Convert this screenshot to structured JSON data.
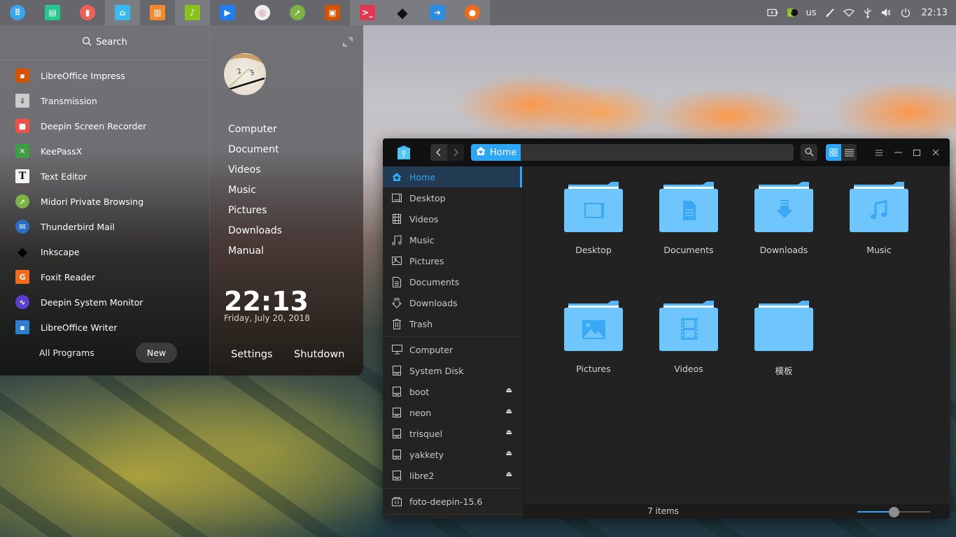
{
  "dock": {
    "apps": [
      {
        "name": "launcher",
        "icon": "launcher-icon",
        "color": "#3aa6f0",
        "active": false
      },
      {
        "name": "deepin-terminal-green",
        "icon": "window-manager-icon",
        "color": "#22c98a",
        "active": false
      },
      {
        "name": "screen-recorder",
        "icon": "screen-recorder-icon",
        "color": "#f06055",
        "active": false
      },
      {
        "name": "file-manager",
        "icon": "file-manager-icon",
        "color": "#3ab8f0",
        "active": true
      },
      {
        "name": "app-store",
        "icon": "app-store-icon",
        "color": "#f28a2b",
        "active": false
      },
      {
        "name": "music",
        "icon": "music-icon",
        "color": "#8ac21b",
        "active": true
      },
      {
        "name": "video-player",
        "icon": "video-player-icon",
        "color": "#1f7ff0",
        "active": false
      },
      {
        "name": "settings",
        "icon": "settings-icon",
        "color": "#ef6b7a",
        "active": false
      },
      {
        "name": "midori",
        "icon": "browser-icon",
        "color": "#7cb342",
        "active": false
      },
      {
        "name": "libreoffice-impress",
        "icon": "impress-icon",
        "color": "#d35400",
        "active": false
      },
      {
        "name": "terminal",
        "icon": "terminal-icon",
        "color": "#e0384e",
        "active": true
      },
      {
        "name": "inkscape",
        "icon": "inkscape-icon",
        "color": "#111111",
        "active": true
      },
      {
        "name": "remote-assist",
        "icon": "remote-icon",
        "color": "#2a8de0",
        "active": true
      },
      {
        "name": "firefox",
        "icon": "firefox-icon",
        "color": "#f26b1d",
        "active": true
      }
    ]
  },
  "tray": {
    "battery_icon": "battery-charging-icon",
    "music_icon": "music-tray-icon",
    "keyboard_layout": "us",
    "pen_icon": "pen-icon",
    "wifi_icon": "wifi-icon",
    "usb_icon": "usb-icon",
    "volume_icon": "volume-icon",
    "power_icon": "power-icon",
    "clock": "22:13"
  },
  "launcher": {
    "search_placeholder": "Search",
    "apps": [
      {
        "label": "LibreOffice Impress",
        "icon": "impress-icon",
        "color": "#d35400"
      },
      {
        "label": "Transmission",
        "icon": "transmission-icon",
        "color": "#cccccc"
      },
      {
        "label": "Deepin Screen Recorder",
        "icon": "screen-recorder-icon",
        "color": "#f0504a"
      },
      {
        "label": "KeePassX",
        "icon": "keepassx-icon",
        "color": "#3aa043"
      },
      {
        "label": "Text Editor",
        "icon": "text-editor-icon",
        "color": "#f4f4f4"
      },
      {
        "label": "Midori Private Browsing",
        "icon": "midori-icon",
        "color": "#7cb342"
      },
      {
        "label": "Thunderbird Mail",
        "icon": "thunderbird-icon",
        "color": "#2b6fc4"
      },
      {
        "label": "Inkscape",
        "icon": "inkscape-icon",
        "color": "#111111"
      },
      {
        "label": "Foxit Reader",
        "icon": "foxit-icon",
        "color": "#f26b1d"
      },
      {
        "label": "Deepin System Monitor",
        "icon": "system-monitor-icon",
        "color": "#5b3fd0"
      },
      {
        "label": "LibreOffice Writer",
        "icon": "writer-icon",
        "color": "#2a7fcf"
      }
    ],
    "all_programs_label": "All Programs",
    "new_label": "New",
    "places": [
      "Computer",
      "Document",
      "Videos",
      "Music",
      "Pictures",
      "Downloads",
      "Manual"
    ],
    "time": "22:13",
    "date": "Friday, July 20, 2018",
    "settings_label": "Settings",
    "shutdown_label": "Shutdown"
  },
  "file_manager": {
    "breadcrumb": "Home",
    "accent": "#2ca7f8",
    "sidebar": {
      "places": [
        {
          "label": "Home",
          "icon": "home-icon",
          "active": true
        },
        {
          "label": "Desktop",
          "icon": "desktop-icon"
        },
        {
          "label": "Videos",
          "icon": "videos-icon"
        },
        {
          "label": "Music",
          "icon": "music-icon"
        },
        {
          "label": "Pictures",
          "icon": "pictures-icon"
        },
        {
          "label": "Documents",
          "icon": "documents-icon"
        },
        {
          "label": "Downloads",
          "icon": "downloads-icon"
        },
        {
          "label": "Trash",
          "icon": "trash-icon"
        }
      ],
      "devices": [
        {
          "label": "Computer",
          "icon": "computer-icon",
          "eject": false
        },
        {
          "label": "System Disk",
          "icon": "disk-icon",
          "eject": false
        },
        {
          "label": "boot",
          "icon": "disk-icon",
          "eject": true
        },
        {
          "label": "neon",
          "icon": "disk-icon",
          "eject": true
        },
        {
          "label": "trisquel",
          "icon": "disk-icon",
          "eject": true
        },
        {
          "label": "yakkety",
          "icon": "disk-icon",
          "eject": true
        },
        {
          "label": "libre2",
          "icon": "disk-icon",
          "eject": true
        }
      ],
      "bookmarks": [
        {
          "label": "foto-deepin-15.6",
          "icon": "network-folder-icon"
        }
      ]
    },
    "folders": [
      {
        "label": "Desktop",
        "emblem": "desktop"
      },
      {
        "label": "Documents",
        "emblem": "documents"
      },
      {
        "label": "Downloads",
        "emblem": "downloads"
      },
      {
        "label": "Music",
        "emblem": "music"
      },
      {
        "label": "Pictures",
        "emblem": "pictures"
      },
      {
        "label": "Videos",
        "emblem": "videos"
      },
      {
        "label": "模板",
        "emblem": "none"
      }
    ],
    "status": "7 items",
    "icon_size_level": 0.5
  }
}
